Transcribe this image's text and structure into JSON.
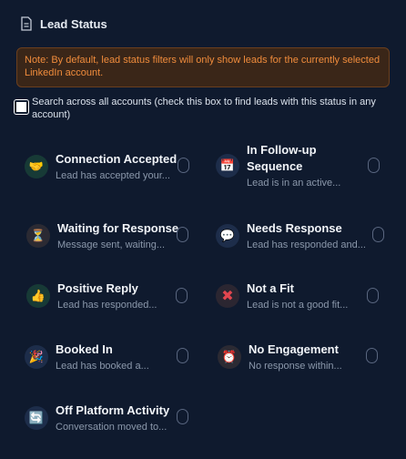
{
  "header": {
    "title": "Lead Status"
  },
  "notice": {
    "text": "Note: By default, lead status filters will only show leads for the currently selected LinkedIn account."
  },
  "search": {
    "label": "Search across all accounts (check this box to find leads with this status in any account)",
    "checked": false
  },
  "statuses": [
    {
      "title": "Connection Accepted",
      "subtitle": "Lead has accepted your...",
      "icon": "handshake-icon",
      "glyph": "🤝"
    },
    {
      "title": "In Follow-up Sequence",
      "subtitle": "Lead is in an active...",
      "icon": "calendar-icon",
      "glyph": "📅"
    },
    {
      "title": "Waiting for Response",
      "subtitle": "Message sent, waiting...",
      "icon": "hourglass-icon",
      "glyph": "⏳"
    },
    {
      "title": "Needs Response",
      "subtitle": "Lead has responded and...",
      "icon": "reply-chat-icon",
      "glyph": "💬"
    },
    {
      "title": "Positive Reply",
      "subtitle": "Lead has responded...",
      "icon": "thumbs-up-icon",
      "glyph": "👍"
    },
    {
      "title": "Not a Fit",
      "subtitle": "Lead is not a good fit...",
      "icon": "cross-mark-icon",
      "glyph": "✖"
    },
    {
      "title": "Booked In",
      "subtitle": "Lead has booked a...",
      "icon": "party-popper-icon",
      "glyph": "🎉"
    },
    {
      "title": "No Engagement",
      "subtitle": "No response within...",
      "icon": "alarm-clock-icon",
      "glyph": "⏰"
    },
    {
      "title": "Off Platform Activity",
      "subtitle": "Conversation moved to...",
      "icon": "refresh-icon",
      "glyph": "🔄"
    }
  ],
  "colors": {
    "background": "#0f1a2e",
    "notice_bg": "#3a2618",
    "notice_text": "#f08c3c",
    "badge_green": "#173a36",
    "badge_brown": "#2b2a33",
    "badge_blue": "#1d2d4a",
    "cross_red": "#e2464f"
  }
}
